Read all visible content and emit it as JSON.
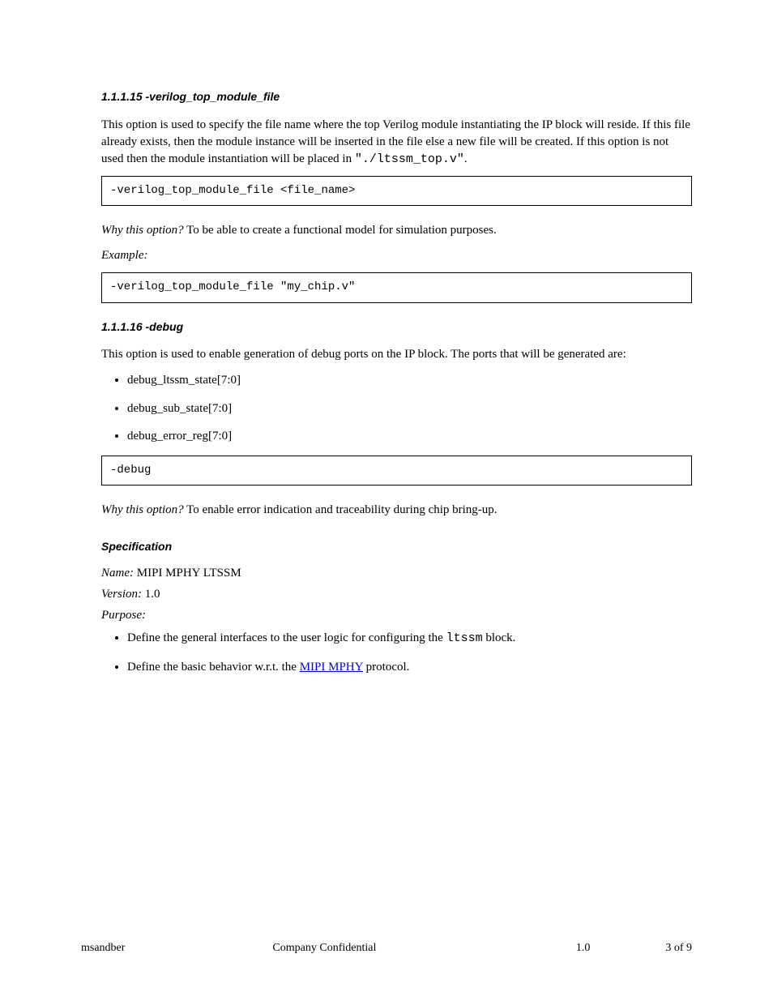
{
  "section1": {
    "heading": "1.1.1.15 -verilog_top_module_file",
    "desc_pre": "This option is used to specify the file name where the top Verilog module instantiating the IP block will reside. If this file already exists, then the module instance will be inserted in the file else a new file will be created. If this option is not used then the module instantiation will be placed in ",
    "desc_file": "\"./ltssm_top.v\"",
    "desc_post": ".",
    "code": "-verilog_top_module_file <file_name>"
  },
  "section2": {
    "why_label": "Why this option?",
    "why_text": "To be able to create a functional model for simulation purposes.",
    "example_label": "Example:",
    "example": "-verilog_top_module_file \"my_chip.v\"",
    "heading": "1.1.1.16 -debug",
    "desc": "This option is used to enable generation of debug ports on the IP block. The ports that will be generated are:",
    "bullets": [
      "debug_ltssm_state[7:0]",
      "debug_sub_state[7:0]",
      "debug_error_reg[7:0]"
    ],
    "code": "-debug",
    "why_label2": "Why this option?",
    "why_text2": "To enable error indication and traceability during chip bring-up."
  },
  "spec": {
    "heading": "Specification",
    "name_label": "Name: ",
    "name_value": "MIPI MPHY LTSSM",
    "version_label": "Version: ",
    "version_value": "1.0",
    "purpose_label": "Purpose:",
    "bullets": [
      {
        "pre": "Define the general interfaces to the user logic for configuring the ",
        "mono": "ltssm",
        "post": " block."
      },
      {
        "pre": "Define the basic behavior w.r.t. the ",
        "link_text": "MIPI MPHY",
        "post": " protocol."
      }
    ]
  },
  "footer": {
    "left": "msandber                                                    Company Confidential",
    "mid": "1.0",
    "right": "3 of 9"
  }
}
